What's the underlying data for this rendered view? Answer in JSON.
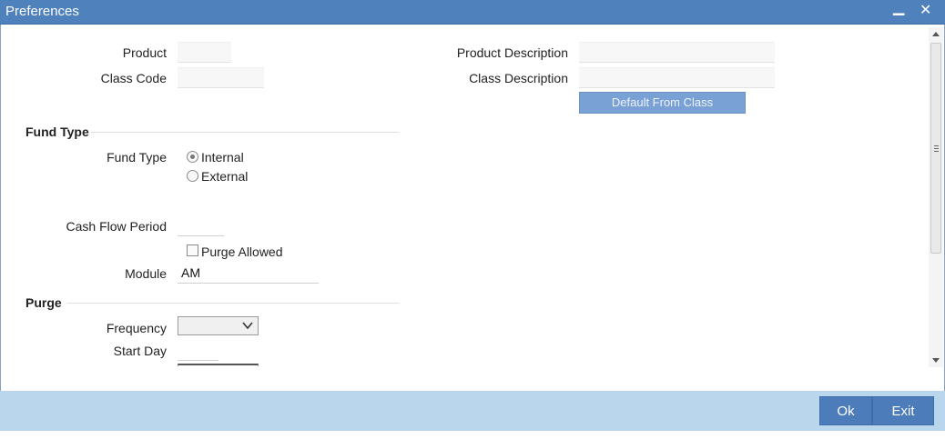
{
  "window": {
    "title": "Preferences",
    "minimize_glyph": "▁",
    "close_glyph": "✕"
  },
  "header_fields": {
    "product_label": "Product",
    "product_value": "",
    "class_code_label": "Class Code",
    "class_code_value": "",
    "product_description_label": "Product Description",
    "product_description_value": "",
    "class_description_label": "Class Description",
    "class_description_value": "",
    "default_from_class_button": "Default From Class"
  },
  "fund_type_section": {
    "heading": "Fund Type",
    "field_label": "Fund Type",
    "options": [
      {
        "label": "Internal",
        "selected": true
      },
      {
        "label": "External",
        "selected": false
      }
    ]
  },
  "details": {
    "cash_flow_period_label": "Cash Flow Period",
    "cash_flow_period_value": "",
    "purge_allowed_label": "Purge Allowed",
    "purge_allowed_checked": false,
    "module_label": "Module",
    "module_value": "AM"
  },
  "purge_section": {
    "heading": "Purge",
    "frequency_label": "Frequency",
    "frequency_value": "",
    "start_day_label": "Start Day",
    "start_day_value": ""
  },
  "footer": {
    "ok_button": "Ok",
    "exit_button": "Exit"
  },
  "colors": {
    "titlebar": "#4f81bd",
    "footer": "#b9d6ec",
    "button": "#4c7cb9",
    "default_button": "#7aa1d6"
  }
}
